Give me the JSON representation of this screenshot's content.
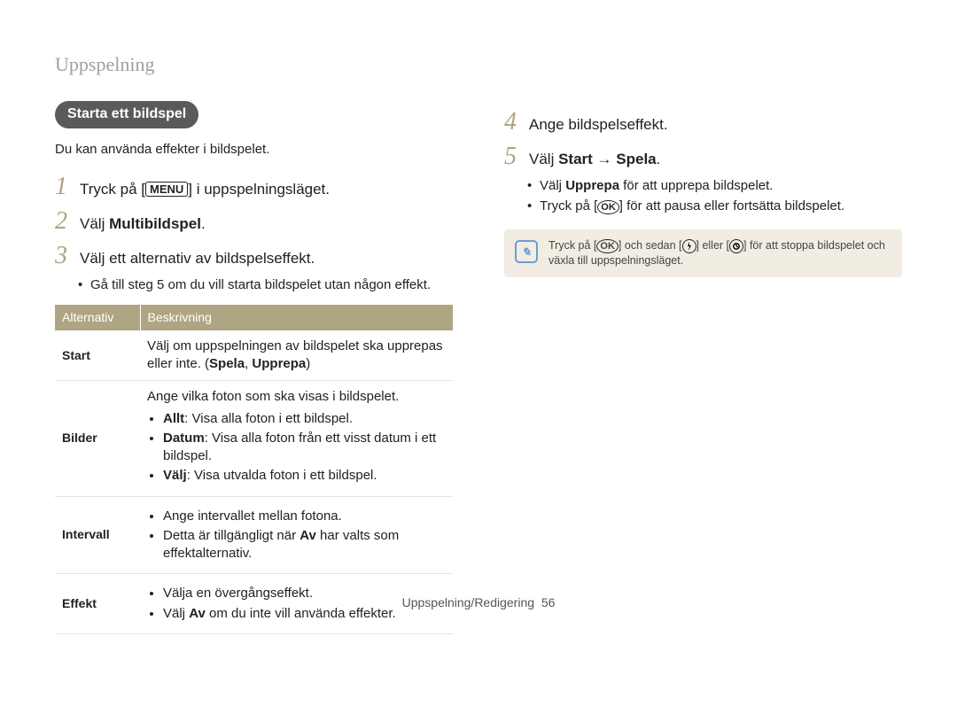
{
  "page": {
    "section_title": "Uppspelning",
    "footer_label": "Uppspelning/Redigering",
    "footer_page": "56"
  },
  "heading_pill": "Starta ett bildspel",
  "intro": "Du kan använda effekter i bildspelet.",
  "glyphs": {
    "menu": "MENU",
    "ok": "OK"
  },
  "left_steps": {
    "s1": {
      "num": "1",
      "pre": "Tryck på [",
      "post": "] i uppspelningsläget."
    },
    "s2": {
      "num": "2",
      "pre": "Välj ",
      "bold": "Multibildspel",
      "post": "."
    },
    "s3": {
      "num": "3",
      "text": "Välj ett alternativ av bildspelseffekt.",
      "bullet1": "Gå till steg 5 om du vill starta bildspelet utan någon effekt."
    }
  },
  "table": {
    "head_col1": "Alternativ",
    "head_col2": "Beskrivning",
    "rows": {
      "start": {
        "label": "Start",
        "desc_pre": "Välj om uppspelningen av bildspelet ska upprepas eller inte. (",
        "desc_b1": "Spela",
        "desc_sep": ", ",
        "desc_b2": "Upprepa",
        "desc_post": ")"
      },
      "bilder": {
        "label": "Bilder",
        "lead": "Ange vilka foton som ska visas i bildspelet.",
        "li1_b": "Allt",
        "li1_post": ": Visa alla foton i ett bildspel.",
        "li2_b": "Datum",
        "li2_post": ": Visa alla foton från ett visst datum i ett bildspel.",
        "li3_b": "Välj",
        "li3_post": ": Visa utvalda foton i ett bildspel."
      },
      "intervall": {
        "label": "Intervall",
        "li1": "Ange intervallet mellan fotona.",
        "li2_pre": "Detta är tillgängligt när ",
        "li2_b": "Av",
        "li2_post": " har valts som effektalternativ."
      },
      "effekt": {
        "label": "Effekt",
        "li1": "Välja en övergångseffekt.",
        "li2_pre": "Välj ",
        "li2_b": "Av",
        "li2_post": " om du inte vill använda effekter."
      }
    }
  },
  "right_steps": {
    "s4": {
      "num": "4",
      "text": "Ange bildspelseffekt."
    },
    "s5": {
      "num": "5",
      "pre": "Välj ",
      "b1": "Start",
      "mid": " → ",
      "b2": "Spela",
      "post": "."
    },
    "bullets": {
      "b1_pre": "Välj ",
      "b1_b": "Upprepa",
      "b1_post": " för att upprepa bildspelet.",
      "b2_pre": "Tryck på [",
      "b2_post": "] för att pausa eller fortsätta bildspelet."
    }
  },
  "note": {
    "pre": "Tryck på [",
    "mid1": "] och sedan [",
    "mid2": "] eller [",
    "post": "] för att stoppa bildspelet och växla till uppspelningsläget."
  }
}
